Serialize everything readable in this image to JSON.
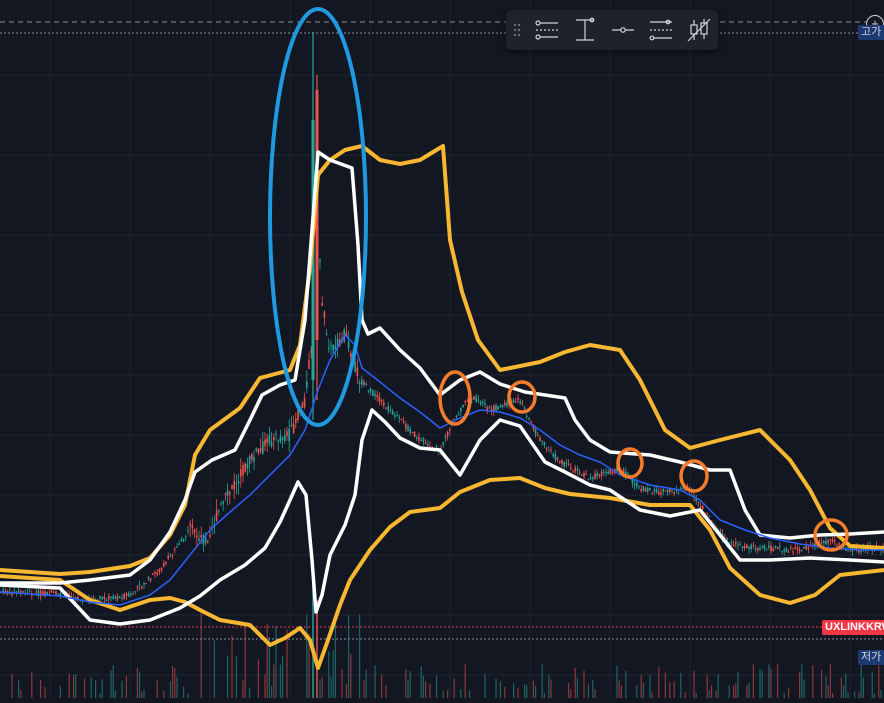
{
  "symbol_tag": "UXLINKKRW",
  "high_label": "고가",
  "low_label": "저가",
  "plus_symbol": "+",
  "toolbar": {
    "drag_handle": "drag-handle-icon",
    "buttons": [
      {
        "name": "horizontal-ray-settings-icon"
      },
      {
        "name": "price-range-icon"
      },
      {
        "name": "horizontal-line-icon"
      },
      {
        "name": "parallel-lines-icon"
      },
      {
        "name": "candlestick-icon"
      }
    ]
  },
  "colors": {
    "background": "#131722",
    "grid": "#1f2433",
    "outer_band": "#f7b731",
    "inner_band": "#ffffff",
    "middle_line": "#2962ff",
    "candle_up": "#26a69a",
    "candle_down": "#ef5350",
    "ellipse_annotation": "#1f9ae0",
    "circle_annotation": "#f57c2a",
    "symbol_tag": "#f23645"
  }
}
